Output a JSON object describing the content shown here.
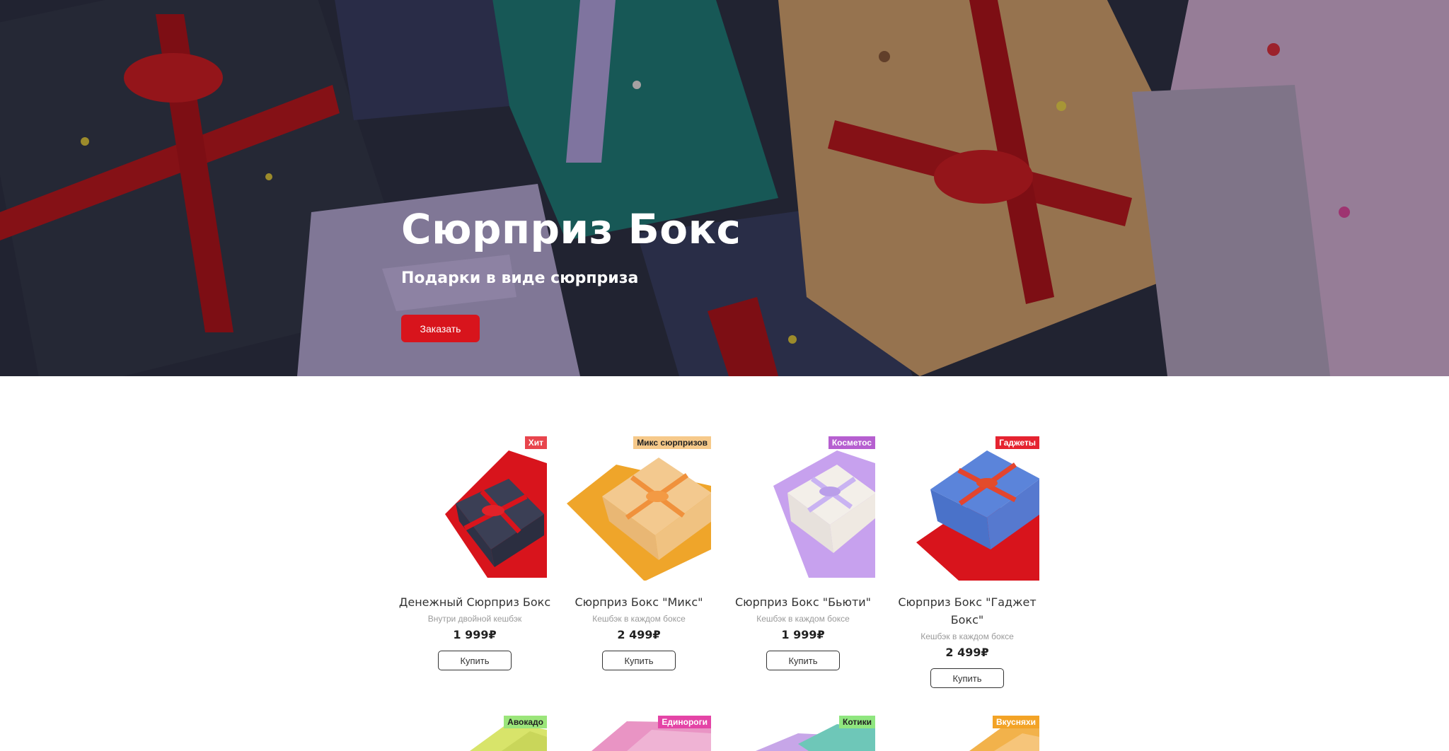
{
  "hero": {
    "title": "Сюрприз Бокс",
    "subtitle": "Подарки в виде сюрприза",
    "cta_label": "Заказать",
    "accent_color": "#d8141c"
  },
  "products": [
    {
      "badge": "Хит",
      "badge_color": "#e8454d",
      "name": "Денежный Сюрприз Бокс",
      "desc": "Внутри двойной кешбэк",
      "price": "1 999₽",
      "buy_label": "Купить",
      "wrap_color": "#3b3f55",
      "bg_color": "#d8141c"
    },
    {
      "badge": "Микс сюрпризов",
      "badge_color": "#f6c98a",
      "name": "Сюрприз Бокс \"Микс\"",
      "desc": "Кешбэк в каждом боксе",
      "price": "2 499₽",
      "buy_label": "Купить",
      "wrap_color": "#f3c98f",
      "bg_color": "#efa52a"
    },
    {
      "badge": "Косметос",
      "badge_color": "#b65fd0",
      "name": "Сюрприз Бокс \"Бьюти\"",
      "desc": "Кешбэк в каждом боксе",
      "price": "1 999₽",
      "buy_label": "Купить",
      "wrap_color": "#f1eef0",
      "bg_color": "#c7a1ee"
    },
    {
      "badge": "Гаджеты",
      "badge_color": "#e52330",
      "name": "Сюрприз Бокс \"Гаджет Бокс\"",
      "desc": "Кешбэк в каждом боксе",
      "price": "2 499₽",
      "buy_label": "Купить",
      "wrap_color": "#5680d8",
      "bg_color": "#d8141c"
    }
  ],
  "products_row2": [
    {
      "badge": "Авокадо",
      "badge_color": "#9be57a",
      "wrap_color": "#d8e46a"
    },
    {
      "badge": "Единороги",
      "badge_color": "#e444a6",
      "wrap_color": "#e994c4"
    },
    {
      "badge": "Котики",
      "badge_color": "#8fe67f",
      "wrap_color": "#c7a6e8"
    },
    {
      "badge": "Вкусняхи",
      "badge_color": "#f3a326",
      "wrap_color": "#f2b24b"
    }
  ]
}
